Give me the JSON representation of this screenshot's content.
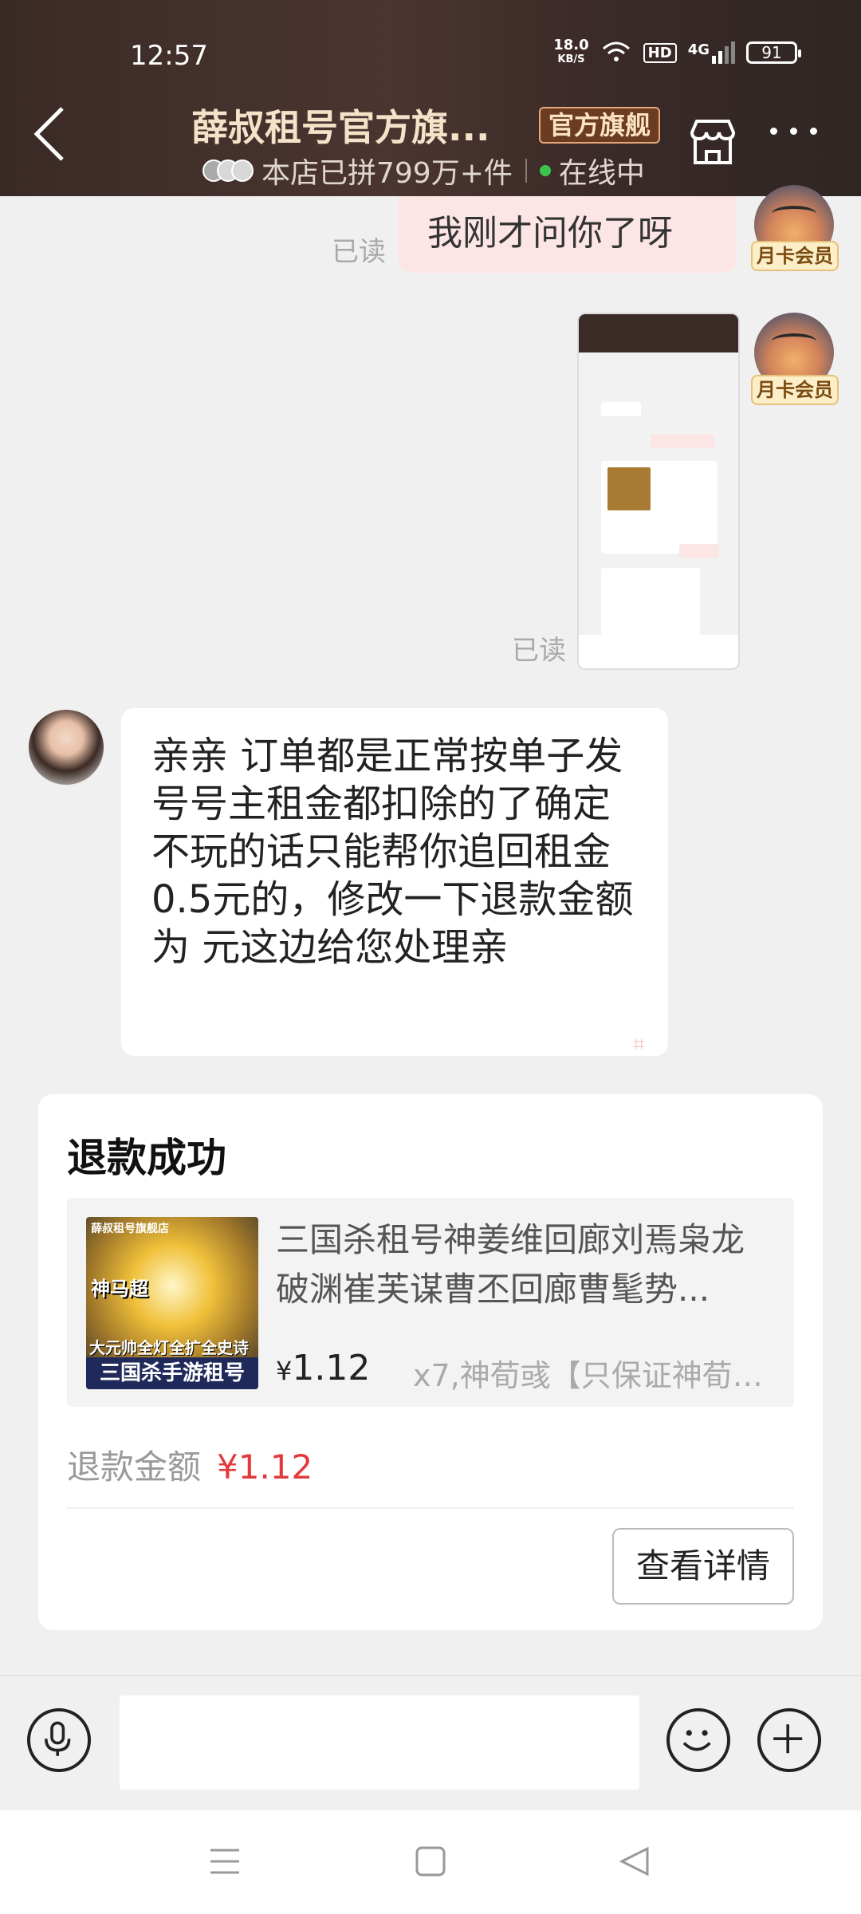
{
  "status_bar": {
    "time": "12:57",
    "speed_value": "18.0",
    "speed_unit": "KB/S",
    "hd": "HD",
    "network": "4G",
    "battery": "91"
  },
  "header": {
    "title": "薛叔租号官方旗...",
    "badge": "官方旗舰",
    "sales": "本店已拼799万+件",
    "online": "在线中"
  },
  "chat": {
    "read_label": "已读",
    "vip_label": "月卡会员",
    "my_message": "我刚才问你了呀",
    "shop_message": "亲亲 订单都是正常按单子发号号主租金都扣除的了确定不玩的话只能帮你追回租金  0.5元的，修改一下退款金额为  元这边给您处理亲"
  },
  "refund_card": {
    "title": "退款成功",
    "product_name": "三国杀租号神姜维回廊刘焉枭龙破渊崔芙谋曹丕回廊曹髦势...",
    "price_currency": "¥",
    "price": "1.12",
    "spec": "x7,神荀彧【只保证神荀彧...",
    "refund_label": "退款金额",
    "refund_amount": "¥1.12",
    "detail_button": "查看详情",
    "thumb_texts": {
      "shop": "薛叔租号旗舰店",
      "hero": "神马超",
      "line": "大元帅全灯全扩全史诗",
      "banner": "三国杀手游租号"
    }
  },
  "input": {
    "placeholder": ""
  },
  "colors": {
    "header_bg": "#3a2a26",
    "accent_red": "#e4393c",
    "online_green": "#3cc44c",
    "my_bubble": "#fce5e5"
  }
}
